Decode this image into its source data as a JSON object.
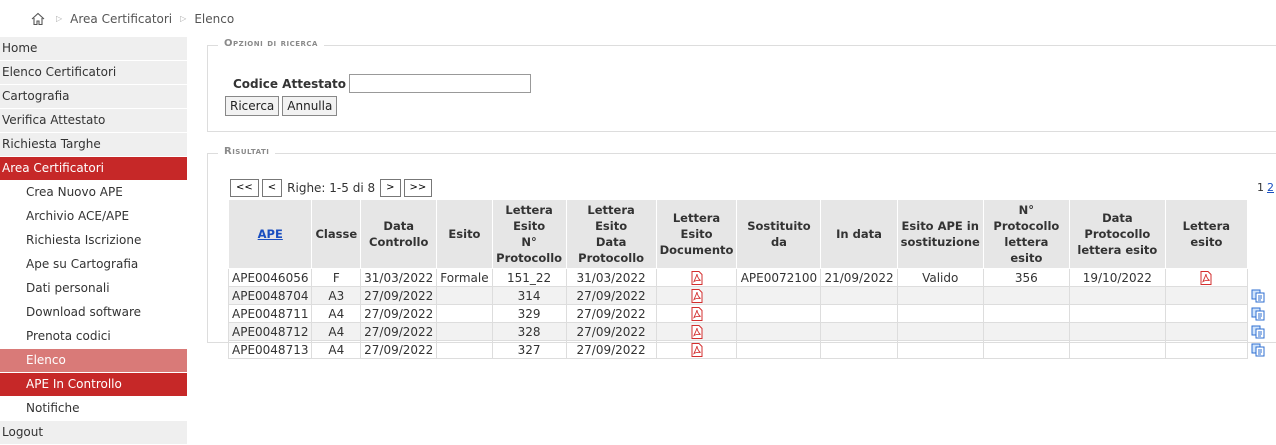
{
  "breadcrumb": {
    "items": [
      "Area Certificatori",
      "Elenco"
    ]
  },
  "sidebar": {
    "items": [
      {
        "label": "Home"
      },
      {
        "label": "Elenco Certificatori"
      },
      {
        "label": "Cartografia"
      },
      {
        "label": "Verifica Attestato"
      },
      {
        "label": "Richiesta Targhe"
      },
      {
        "label": "Area Certificatori"
      },
      {
        "label": "Crea Nuovo APE"
      },
      {
        "label": "Archivio ACE/APE"
      },
      {
        "label": "Richiesta Iscrizione"
      },
      {
        "label": "Ape su Cartografia"
      },
      {
        "label": "Dati personali"
      },
      {
        "label": "Download software"
      },
      {
        "label": "Prenota codici"
      },
      {
        "label": "Elenco"
      },
      {
        "label": "APE In Controllo"
      },
      {
        "label": "Notifiche"
      },
      {
        "label": "Logout"
      }
    ]
  },
  "search": {
    "legend": "Opzioni di ricerca",
    "field_label": "Codice Attestato",
    "field_value": "",
    "search_button": "Ricerca",
    "cancel_button": "Annulla"
  },
  "results": {
    "legend": "Risultati",
    "pager": {
      "first": "<<",
      "prev": "<",
      "info": "Righe: 1-5 di 8",
      "next": ">",
      "last": ">>",
      "page_current": "1",
      "page_next": "2"
    },
    "columns": [
      [
        "APE"
      ],
      [
        "Classe"
      ],
      [
        "Data",
        "Controllo"
      ],
      [
        "Esito"
      ],
      [
        "Lettera Esito",
        "N° Protocollo"
      ],
      [
        "Lettera Esito",
        "Data Protocollo"
      ],
      [
        "Lettera Esito",
        "Documento"
      ],
      [
        "Sostituito da"
      ],
      [
        "In data"
      ],
      [
        "Esito APE in",
        "sostituzione"
      ],
      [
        "N° Protocollo",
        "lettera esito"
      ],
      [
        "Data Protocollo",
        "lettera esito"
      ],
      [
        "Lettera esito"
      ]
    ],
    "rows": [
      {
        "ape": "APE0046056",
        "classe": "F",
        "data_controllo": "31/03/2022",
        "esito": "Formale",
        "n_protocollo": "151_22",
        "data_protocollo": "31/03/2022",
        "doc": true,
        "sostituito_da": "APE0072100",
        "in_data": "21/09/2022",
        "esito_sost": "Valido",
        "n_prot_lettera": "356",
        "data_prot_lettera": "19/10/2022",
        "lettera": true,
        "copy": false
      },
      {
        "ape": "APE0048704",
        "classe": "A3",
        "data_controllo": "27/09/2022",
        "esito": "",
        "n_protocollo": "314",
        "data_protocollo": "27/09/2022",
        "doc": true,
        "sostituito_da": "",
        "in_data": "",
        "esito_sost": "",
        "n_prot_lettera": "",
        "data_prot_lettera": "",
        "lettera": false,
        "copy": true
      },
      {
        "ape": "APE0048711",
        "classe": "A4",
        "data_controllo": "27/09/2022",
        "esito": "",
        "n_protocollo": "329",
        "data_protocollo": "27/09/2022",
        "doc": true,
        "sostituito_da": "",
        "in_data": "",
        "esito_sost": "",
        "n_prot_lettera": "",
        "data_prot_lettera": "",
        "lettera": false,
        "copy": true
      },
      {
        "ape": "APE0048712",
        "classe": "A4",
        "data_controllo": "27/09/2022",
        "esito": "",
        "n_protocollo": "328",
        "data_protocollo": "27/09/2022",
        "doc": true,
        "sostituito_da": "",
        "in_data": "",
        "esito_sost": "",
        "n_prot_lettera": "",
        "data_prot_lettera": "",
        "lettera": false,
        "copy": true
      },
      {
        "ape": "APE0048713",
        "classe": "A4",
        "data_controllo": "27/09/2022",
        "esito": "",
        "n_protocollo": "327",
        "data_protocollo": "27/09/2022",
        "doc": true,
        "sostituito_da": "",
        "in_data": "",
        "esito_sost": "",
        "n_prot_lettera": "",
        "data_prot_lettera": "",
        "lettera": false,
        "copy": true
      }
    ]
  },
  "icons": {
    "home": "home-icon",
    "pdf": "pdf-icon",
    "copy": "copy-icon"
  },
  "colors": {
    "accent": "#c62828",
    "accent_light": "#d97a78",
    "link": "#1a4fc0"
  }
}
